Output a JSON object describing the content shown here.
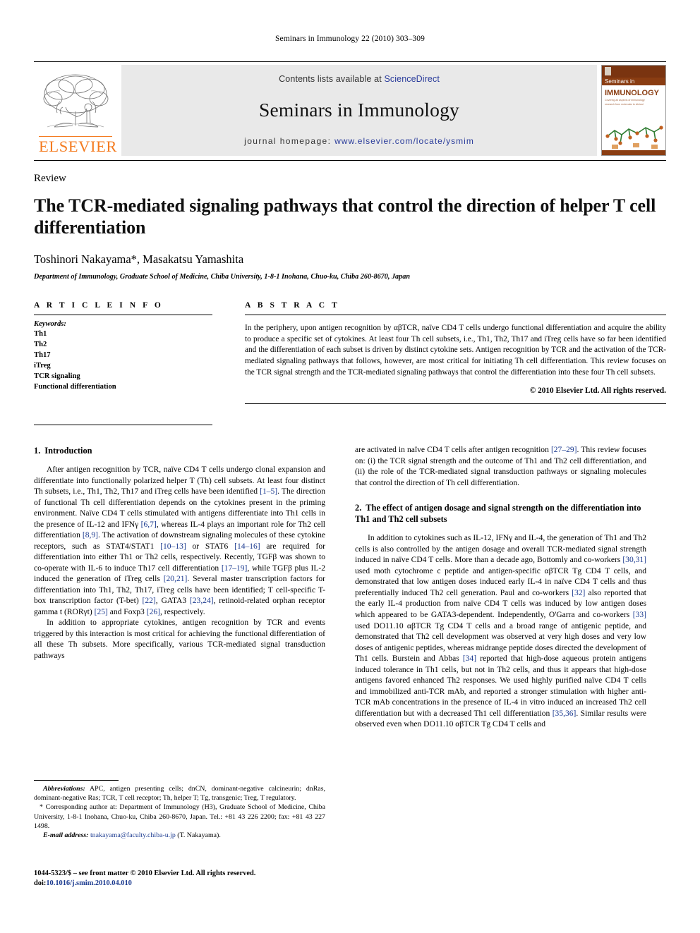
{
  "running_head": "Seminars in Immunology 22 (2010) 303–309",
  "masthead": {
    "publisher_name": "ELSEVIER",
    "contents_prefix": "Contents lists available at ",
    "contents_link": "ScienceDirect",
    "journal_title": "Seminars in Immunology",
    "homepage_prefix": "journal homepage: ",
    "homepage_url": "www.elsevier.com/locate/ysmim",
    "cover": {
      "line1": "Seminars in",
      "line2": "IMMUNOLOGY",
      "subtitle": "Covering all aspects of immunology research from molecular to clinical",
      "bg_color": "#8a3d12",
      "accent_color": "#ffffff"
    },
    "accent_color": "#F47B20",
    "link_color": "#2a3c9b"
  },
  "article": {
    "doctype": "Review",
    "title": "The TCR-mediated signaling pathways that control the direction of helper T cell differentiation",
    "authors": "Toshinori Nakayama*, Masakatsu Yamashita",
    "affiliation": "Department of Immunology, Graduate School of Medicine, Chiba University, 1-8-1 Inohana, Chuo-ku, Chiba 260-8670, Japan"
  },
  "article_info": {
    "heading": "A R T I C L E  I N F O",
    "keywords_label": "Keywords:",
    "keywords": [
      "Th1",
      "Th2",
      "Th17",
      "iTreg",
      "TCR signaling",
      "Functional differentiation"
    ]
  },
  "abstract": {
    "heading": "A B S T R A C T",
    "text": "In the periphery, upon antigen recognition by αβTCR, naïve CD4 T cells undergo functional differentiation and acquire the ability to produce a specific set of cytokines. At least four Th cell subsets, i.e., Th1, Th2, Th17 and iTreg cells have so far been identified and the differentiation of each subset is driven by distinct cytokine sets. Antigen recognition by TCR and the activation of the TCR-mediated signaling pathways that follows, however, are most critical for initiating Th cell differentiation. This review focuses on the TCR signal strength and the TCR-mediated signaling pathways that control the differentiation into these four Th cell subsets.",
    "copyright": "© 2010 Elsevier Ltd. All rights reserved."
  },
  "sections": {
    "intro": {
      "number": "1.",
      "title": "Introduction",
      "para1_a": "After antigen recognition by TCR, naïve CD4 T cells undergo clonal expansion and differentiate into functionally polarized helper T (Th) cell subsets. At least four distinct Th subsets, i.e., Th1, Th2, Th17 and iTreg cells have been identified ",
      "ref1": "[1–5]",
      "para1_b": ". The direction of functional Th cell differentiation depends on the cytokines present in the priming environment. Naïve CD4 T cells stimulated with antigens differentiate into Th1 cells in the presence of IL-12 and IFNγ ",
      "ref2": "[6,7]",
      "para1_c": ", whereas IL-4 plays an important role for Th2 cell differentiation ",
      "ref3": "[8,9]",
      "para1_d": ". The activation of downstream signaling molecules of these cytokine receptors, such as STAT4/STAT1 ",
      "ref4": "[10–13]",
      "para1_e": " or STAT6 ",
      "ref5": "[14–16]",
      "para1_f": " are required for differentiation into either Th1 or Th2 cells, respectively. Recently, TGFβ was shown to co-operate with IL-6 to induce Th17 cell differentiation ",
      "ref6": "[17–19]",
      "para1_g": ", while TGFβ plus IL-2 induced the generation of iTreg cells ",
      "ref7": "[20,21]",
      "para1_h": ". Several master transcription factors for differentiation into Th1, Th2, Th17, iTreg cells have been identified; T cell-specific T-box transcription factor (T-bet) ",
      "ref8": "[22]",
      "para1_i": ", GATA3 ",
      "ref9": "[23,24]",
      "para1_j": ", retinoid-related orphan receptor gamma t (RORγt) ",
      "ref10": "[25]",
      "para1_k": " and Foxp3 ",
      "ref11": "[26]",
      "para1_l": ", respectively.",
      "para2": "In addition to appropriate cytokines, antigen recognition by TCR and events triggered by this interaction is most critical for achieving the functional differentiation of all these Th subsets. More specifically, various TCR-mediated signal transduction pathways",
      "cont_a": "are activated in naïve CD4 T cells after antigen recognition ",
      "ref12": "[27–29]",
      "cont_b": ". This review focuses on: (i) the TCR signal strength and the outcome of Th1 and Th2 cell differentiation, and (ii) the role of the TCR-mediated signal transduction pathways or signaling molecules that control the direction of Th cell differentiation."
    },
    "sec2": {
      "number": "2.",
      "title": "The effect of antigen dosage and signal strength on the differentiation into Th1 and Th2 cell subsets",
      "para_a": "In addition to cytokines such as IL-12, IFNγ and IL-4, the generation of Th1 and Th2 cells is also controlled by the antigen dosage and overall TCR-mediated signal strength induced in naïve CD4 T cells. More than a decade ago, Bottomly and co-workers ",
      "ref13": "[30,31]",
      "para_b": " used moth cytochrome c peptide and antigen-specific αβTCR Tg CD4 T cells, and demonstrated that low antigen doses induced early IL-4 in naïve CD4 T cells and thus preferentially induced Th2 cell generation. Paul and co-workers ",
      "ref14": "[32]",
      "para_c": " also reported that the early IL-4 production from naïve CD4 T cells was induced by low antigen doses which appeared to be GATA3-dependent. Independently, O'Garra and co-workers ",
      "ref15": "[33]",
      "para_d": " used DO11.10 αβTCR Tg CD4 T cells and a broad range of antigenic peptide, and demonstrated that Th2 cell development was observed at very high doses and very low doses of antigenic peptides, whereas midrange peptide doses directed the development of Th1 cells. Burstein and Abbas ",
      "ref16": "[34]",
      "para_e": " reported that high-dose aqueous protein antigens induced tolerance in Th1 cells, but not in Th2 cells, and thus it appears that high-dose antigens favored enhanced Th2 responses. We used highly purified naïve CD4 T cells and immobilized anti-TCR mAb, and reported a stronger stimulation with higher anti-TCR mAb concentrations in the presence of IL-4 in vitro induced an increased Th2 cell differentiation but with a decreased Th1 cell differentiation ",
      "ref17": "[35,36]",
      "para_f": ". Similar results were observed even when DO11.10 αβTCR Tg CD4 T cells and"
    }
  },
  "footnotes": {
    "abbrev_label": "Abbreviations:",
    "abbrev_text": " APC, antigen presenting cells; dnCN, dominant-negative calcineurin; dnRas, dominant-negative Ras; TCR, T cell receptor; Th, helper T; Tg, transgenic; Treg, T regulatory.",
    "corresponding": "* Corresponding author at: Department of Immunology (H3), Graduate School of Medicine, Chiba University, 1-8-1 Inohana, Chuo-ku, Chiba 260-8670, Japan. Tel.: +81 43 226 2200; fax: +81 43 227 1498.",
    "email_label": "E-mail address:",
    "email": "tnakayama@faculty.chiba-u.jp",
    "email_suffix": " (T. Nakayama)."
  },
  "page_footer": {
    "front_matter": "1044-5323/$ – see front matter © 2010 Elsevier Ltd. All rights reserved.",
    "doi_label": "doi:",
    "doi": "10.1016/j.smim.2010.04.010"
  }
}
